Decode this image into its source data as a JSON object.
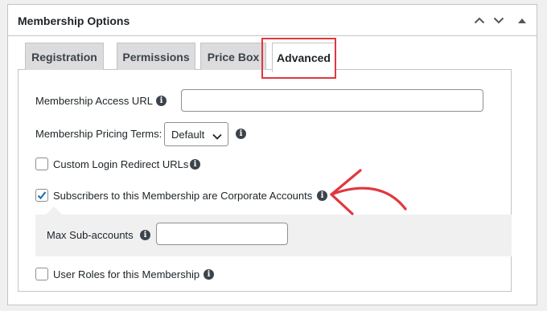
{
  "metabox": {
    "title": "Membership Options",
    "controls": [
      "chevron-up-icon",
      "chevron-down-icon",
      "triangle-toggle-icon"
    ]
  },
  "tabs": [
    {
      "label": "Registration",
      "active": false
    },
    {
      "label": "Permissions",
      "active": false
    },
    {
      "label": "Price Box",
      "active": false
    },
    {
      "label": "Advanced",
      "active": true
    }
  ],
  "fields": {
    "access_url": {
      "label": "Membership Access URL",
      "value": "",
      "icon": "info-icon"
    },
    "pricing_terms": {
      "label": "Membership Pricing Terms:",
      "selected": "Default",
      "icon": "info-icon"
    },
    "custom_login": {
      "label": "Custom Login Redirect URLs",
      "checked": false,
      "icon": "info-icon"
    },
    "corporate": {
      "label": "Subscribers to this Membership are Corporate Accounts",
      "checked": true,
      "icon": "info-icon"
    },
    "max_sub_accounts": {
      "label": "Max Sub-accounts",
      "value": "",
      "icon": "info-icon"
    },
    "user_roles": {
      "label": "User Roles for this Membership",
      "checked": false,
      "icon": "info-icon"
    }
  },
  "colors": {
    "annotation": "#e0383e",
    "checkbox_check": "#2271b1"
  }
}
